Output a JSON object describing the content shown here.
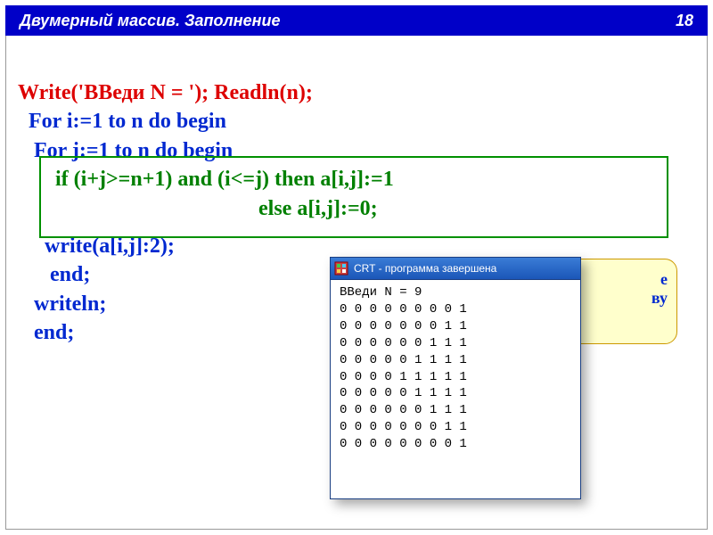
{
  "header": {
    "title": "Двумерный массив. Заполнение",
    "page": "18"
  },
  "code": {
    "l1a": "Write('ВВеди N = '); ",
    "l1b": "Readln(n);",
    "l2": "  For i:=1 to n do begin",
    "l3": "   For j:=1 to n do begin",
    "l4": "       if (i+j>=n+1) and (i<=j) then a[i,j]:=1",
    "l5": "                                             else a[i,j]:=0;",
    "l6": "     write(a[i,j]:2);",
    "l7": "      end;",
    "l8": "   writeln;",
    "l9": "   end;"
  },
  "callout": {
    "line1": "е",
    "line2": "",
    "line3": "ву"
  },
  "crt": {
    "title": "CRT - программа завершена",
    "prompt": "ВВеди N = 9",
    "matrix_rows": [
      "0 0 0 0 0 0 0 0 1",
      "0 0 0 0 0 0 0 1 1",
      "0 0 0 0 0 0 1 1 1",
      "0 0 0 0 0 1 1 1 1",
      "0 0 0 0 1 1 1 1 1",
      "0 0 0 0 0 1 1 1 1",
      "0 0 0 0 0 0 1 1 1",
      "0 0 0 0 0 0 0 1 1",
      "0 0 0 0 0 0 0 0 1"
    ]
  }
}
